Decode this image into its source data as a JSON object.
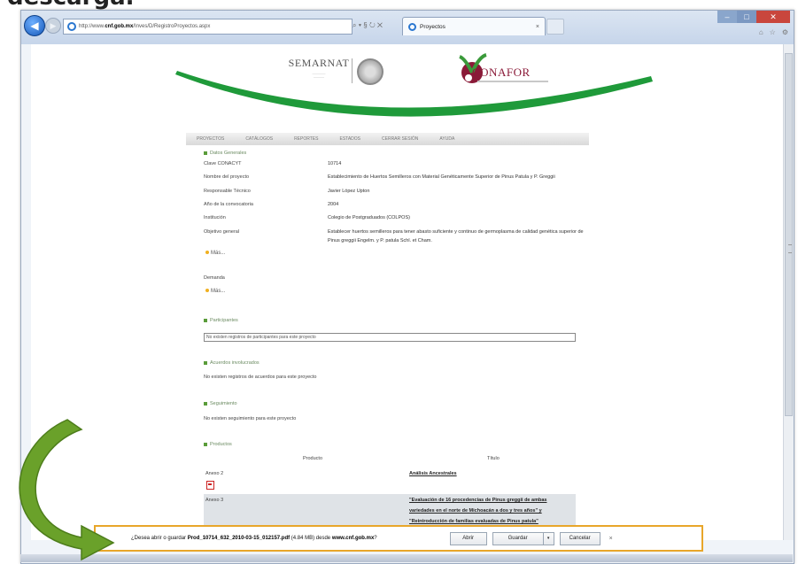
{
  "slide": {
    "heading_fragment": "descarga."
  },
  "browser": {
    "address_prefix": "http://www.",
    "address_domain": "cnf.gob.mx",
    "address_path": "/Inves/D/RegistroProyectos.aspx",
    "address_tools": "⌕ ▾ § ↻ ✕",
    "tab_title": "Proyectos",
    "tab_close": "×",
    "window_controls": {
      "minimize": "–",
      "maximize": "□",
      "close": "✕"
    },
    "tool_icons": {
      "home": "⌂",
      "favorites": "☆",
      "tools": "⚙"
    },
    "icons": {
      "back": "back-arrow-icon",
      "forward": "forward-arrow-icon"
    }
  },
  "site": {
    "semarnat": "SEMARNAT",
    "conafor": "CONAFOR",
    "menu": [
      "Proyectos",
      "Catálogos",
      "Reportes",
      "Estados",
      "Cerrar Sesión",
      "Ayuda"
    ]
  },
  "project": {
    "section_general": "Datos Generales",
    "fields": [
      {
        "label": "Clave CONACYT",
        "value": "10714"
      },
      {
        "label": "Nombre del proyecto",
        "value": "Establecimiento de Huertos Semilleros con Material Genéticamente Superior de Pinus Patula y P. Greggii"
      },
      {
        "label": "Responsable Técnico",
        "value": "Javier López Upton"
      },
      {
        "label": "Año de la convocatoria",
        "value": "2004"
      },
      {
        "label": "Institución",
        "value": "Colegio de Postgraduados (COLPOS)"
      }
    ],
    "objective_label": "Objetivo general",
    "objective_line1": "Establecer huertos semilleros para tener abasto suficiente y continuo de germoplasma de calidad genética superior de",
    "objective_line2": "Pinus greggii Engelm. y P. patula Schl. et Cham.",
    "more_label": "Más...",
    "demand_label": "Demanda",
    "section_participants": "Participantes",
    "participants_msg": "No existen registros de participantes para este proyecto",
    "section_agreements": "Acuerdos involucrados",
    "agreements_msg": "No existen registros de acuerdos para este proyecto",
    "section_followup": "Seguimiento",
    "followup_msg": "No existen seguimiento para este proyecto",
    "section_products": "Productos",
    "products_col_product": "Producto",
    "products_col_title": "Título",
    "products": [
      {
        "id": "Anexo 2",
        "title_line1": "Análisis Ancestrales",
        "title_line2": "",
        "title_line3": ""
      },
      {
        "id": "Anexo 3",
        "title_line1": "\"Evaluación de 16 procedencias de Pinus greggii de ambas",
        "title_line2": "variedades en el norte de Michoacán a dos y tres años\" y",
        "title_line3": "\"Reintroducción de familias evaluadas de Pinus patula\""
      }
    ]
  },
  "download_bar": {
    "prefix": "¿Desea abrir o guardar ",
    "filename": "Prod_10714_632_2010-03-15_012157.pdf",
    "middle": " (4.84 MB) desde ",
    "site": "www.cnf.gob.mx",
    "suffix": "?",
    "open_label": "Abrir",
    "save_label": "Guardar",
    "dropdown_glyph": "▾",
    "cancel_label": "Cancelar",
    "close_glyph": "×"
  },
  "annotation": {
    "arrow_color": "#6aa12a",
    "arrow_icon": "curved-arrow-icon"
  }
}
